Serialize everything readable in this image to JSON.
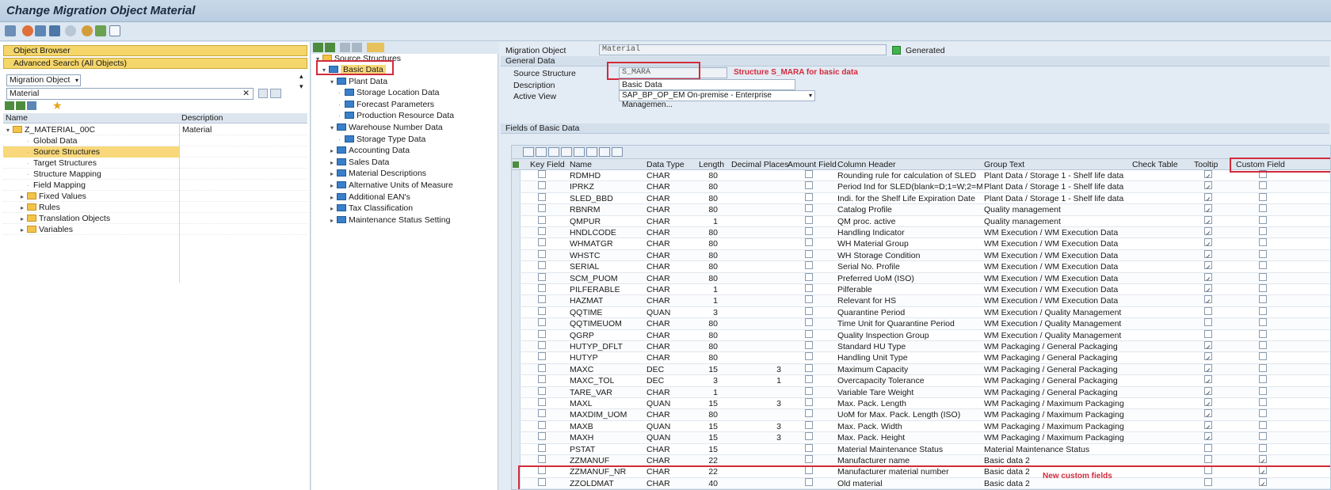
{
  "window": {
    "title": "Change Migration Object Material"
  },
  "toolbar": {
    "icons": [
      "tools-icon",
      "activate-icon",
      "structure-icon",
      "mapping-icon",
      "target-icon",
      "person-icon",
      "persons-icon",
      "layout-icon"
    ]
  },
  "left": {
    "object_browser": "Object Browser",
    "advanced_search": "Advanced Search (All Objects)",
    "dropdown_value": "Migration Object",
    "search_value": "Material",
    "columns": {
      "name": "Name",
      "description": "Description"
    },
    "tree": [
      {
        "label": "Z_MATERIAL_00C",
        "desc": "Material"
      },
      {
        "label": "Global Data"
      },
      {
        "label": "Source Structures"
      },
      {
        "label": "Target Structures"
      },
      {
        "label": "Structure Mapping"
      },
      {
        "label": "Field Mapping"
      },
      {
        "label": "Fixed Values"
      },
      {
        "label": "Rules"
      },
      {
        "label": "Translation Objects"
      },
      {
        "label": "Variables"
      }
    ]
  },
  "middle": {
    "root": "Source Structures",
    "nodes": [
      "Basic Data",
      "Plant Data",
      "Storage Location Data",
      "Forecast Parameters",
      "Production Resource Data",
      "Warehouse Number Data",
      "Storage Type Data",
      "Accounting Data",
      "Sales Data",
      "Material Descriptions",
      "Alternative Units of Measure",
      "Additional EAN's",
      "Tax Classification",
      "Maintenance Status Setting"
    ]
  },
  "right": {
    "migration_object_label": "Migration Object",
    "migration_object_value": "Material",
    "status": "Generated",
    "general_data": "General Data",
    "source_structure_label": "Source Structure",
    "source_structure_value": "S_MARA",
    "source_note": "Structure S_MARA for basic data",
    "description_label": "Description",
    "description_value": "Basic Data",
    "active_view_label": "Active View",
    "active_view_value": "SAP_BP_OP_EM On-premise - Enterprise Managemen...",
    "fields_title": "Fields of Basic Data",
    "custom_note": "New custom fields",
    "columns": {
      "key": "Key Field",
      "name": "Name",
      "type": "Data Type",
      "length": "Length",
      "decimals": "Decimal Places",
      "amount": "Amount Field",
      "header": "Column Header",
      "group": "Group Text",
      "check": "Check Table",
      "tooltip": "Tooltip",
      "custom": "Custom Field"
    },
    "rows": [
      {
        "name": "RDMHD",
        "type": "CHAR",
        "len": "80",
        "dec": "",
        "header": "Rounding rule for calculation of SLED",
        "group": "Plant Data / Storage 1 - Shelf life data",
        "tip": true,
        "custom": false
      },
      {
        "name": "IPRKZ",
        "type": "CHAR",
        "len": "80",
        "dec": "",
        "header": "Period Ind for SLED(blank=D;1=W;2=M;3=",
        "group": "Plant Data / Storage 1 - Shelf life data",
        "tip": true,
        "custom": false
      },
      {
        "name": "SLED_BBD",
        "type": "CHAR",
        "len": "80",
        "dec": "",
        "header": "Indi. for the Shelf Life Expiration Date",
        "group": "Plant Data / Storage 1 - Shelf life data",
        "tip": true,
        "custom": false
      },
      {
        "name": "RBNRM",
        "type": "CHAR",
        "len": "80",
        "dec": "",
        "header": "Catalog Profile",
        "group": "Quality management",
        "tip": true,
        "custom": false
      },
      {
        "name": "QMPUR",
        "type": "CHAR",
        "len": "1",
        "dec": "",
        "header": "QM proc. active",
        "group": "Quality management",
        "tip": true,
        "custom": false
      },
      {
        "name": "HNDLCODE",
        "type": "CHAR",
        "len": "80",
        "dec": "",
        "header": "Handling Indicator",
        "group": "WM Execution / WM Execution Data",
        "tip": true,
        "custom": false
      },
      {
        "name": "WHMATGR",
        "type": "CHAR",
        "len": "80",
        "dec": "",
        "header": "WH Material Group",
        "group": "WM Execution / WM Execution Data",
        "tip": true,
        "custom": false
      },
      {
        "name": "WHSTC",
        "type": "CHAR",
        "len": "80",
        "dec": "",
        "header": "WH Storage Condition",
        "group": "WM Execution / WM Execution Data",
        "tip": true,
        "custom": false
      },
      {
        "name": "SERIAL",
        "type": "CHAR",
        "len": "80",
        "dec": "",
        "header": "Serial No. Profile",
        "group": "WM Execution / WM Execution Data",
        "tip": true,
        "custom": false
      },
      {
        "name": "SCM_PUOM",
        "type": "CHAR",
        "len": "80",
        "dec": "",
        "header": "Preferred UoM (ISO)",
        "group": "WM Execution / WM Execution Data",
        "tip": true,
        "custom": false
      },
      {
        "name": "PILFERABLE",
        "type": "CHAR",
        "len": "1",
        "dec": "",
        "header": "Pilferable",
        "group": "WM Execution / WM Execution Data",
        "tip": true,
        "custom": false
      },
      {
        "name": "HAZMAT",
        "type": "CHAR",
        "len": "1",
        "dec": "",
        "header": "Relevant for HS",
        "group": "WM Execution / WM Execution Data",
        "tip": true,
        "custom": false
      },
      {
        "name": "QQTIME",
        "type": "QUAN",
        "len": "3",
        "dec": "",
        "header": "Quarantine Period",
        "group": "WM Execution / Quality Management",
        "tip": false,
        "custom": false
      },
      {
        "name": "QQTIMEUOM",
        "type": "CHAR",
        "len": "80",
        "dec": "",
        "header": "Time Unit for Quarantine Period",
        "group": "WM Execution / Quality Management",
        "tip": false,
        "custom": false
      },
      {
        "name": "QGRP",
        "type": "CHAR",
        "len": "80",
        "dec": "",
        "header": "Quality Inspection Group",
        "group": "WM Execution / Quality Management",
        "tip": false,
        "custom": false
      },
      {
        "name": "HUTYP_DFLT",
        "type": "CHAR",
        "len": "80",
        "dec": "",
        "header": "Standard HU Type",
        "group": "WM Packaging / General Packaging",
        "tip": true,
        "custom": false
      },
      {
        "name": "HUTYP",
        "type": "CHAR",
        "len": "80",
        "dec": "",
        "header": "Handling Unit Type",
        "group": "WM Packaging / General Packaging",
        "tip": true,
        "custom": false
      },
      {
        "name": "MAXC",
        "type": "DEC",
        "len": "15",
        "dec": "3",
        "header": "Maximum Capacity",
        "group": "WM Packaging / General Packaging",
        "tip": true,
        "custom": false
      },
      {
        "name": "MAXC_TOL",
        "type": "DEC",
        "len": "3",
        "dec": "1",
        "header": "Overcapacity Tolerance",
        "group": "WM Packaging / General Packaging",
        "tip": true,
        "custom": false
      },
      {
        "name": "TARE_VAR",
        "type": "CHAR",
        "len": "1",
        "dec": "",
        "header": "Variable Tare Weight",
        "group": "WM Packaging / General Packaging",
        "tip": true,
        "custom": false
      },
      {
        "name": "MAXL",
        "type": "QUAN",
        "len": "15",
        "dec": "3",
        "header": "Max. Pack. Length",
        "group": "WM Packaging / Maximum Packaging",
        "tip": true,
        "custom": false
      },
      {
        "name": "MAXDIM_UOM",
        "type": "CHAR",
        "len": "80",
        "dec": "",
        "header": "UoM for Max. Pack. Length (ISO)",
        "group": "WM Packaging / Maximum Packaging",
        "tip": true,
        "custom": false
      },
      {
        "name": "MAXB",
        "type": "QUAN",
        "len": "15",
        "dec": "3",
        "header": "Max. Pack. Width",
        "group": "WM Packaging / Maximum Packaging",
        "tip": true,
        "custom": false
      },
      {
        "name": "MAXH",
        "type": "QUAN",
        "len": "15",
        "dec": "3",
        "header": "Max. Pack. Height",
        "group": "WM Packaging / Maximum Packaging",
        "tip": true,
        "custom": false
      },
      {
        "name": "PSTAT",
        "type": "CHAR",
        "len": "15",
        "dec": "",
        "header": "Material Maintenance Status",
        "group": "Material Maintenance Status",
        "tip": false,
        "custom": false
      },
      {
        "name": "ZZMANUF",
        "type": "CHAR",
        "len": "22",
        "dec": "",
        "header": "Manufacturer name",
        "group": "Basic data 2",
        "tip": false,
        "custom": true
      },
      {
        "name": "ZZMANUF_NR",
        "type": "CHAR",
        "len": "22",
        "dec": "",
        "header": "Manufacturer material number",
        "group": "Basic data 2",
        "tip": false,
        "custom": true
      },
      {
        "name": "ZZOLDMAT",
        "type": "CHAR",
        "len": "40",
        "dec": "",
        "header": "Old material",
        "group": "Basic data 2",
        "tip": false,
        "custom": true
      }
    ]
  },
  "colors": {
    "highlight": "#f8d87a",
    "annotation": "#d22b3c",
    "status_green": "#3fb44a"
  }
}
